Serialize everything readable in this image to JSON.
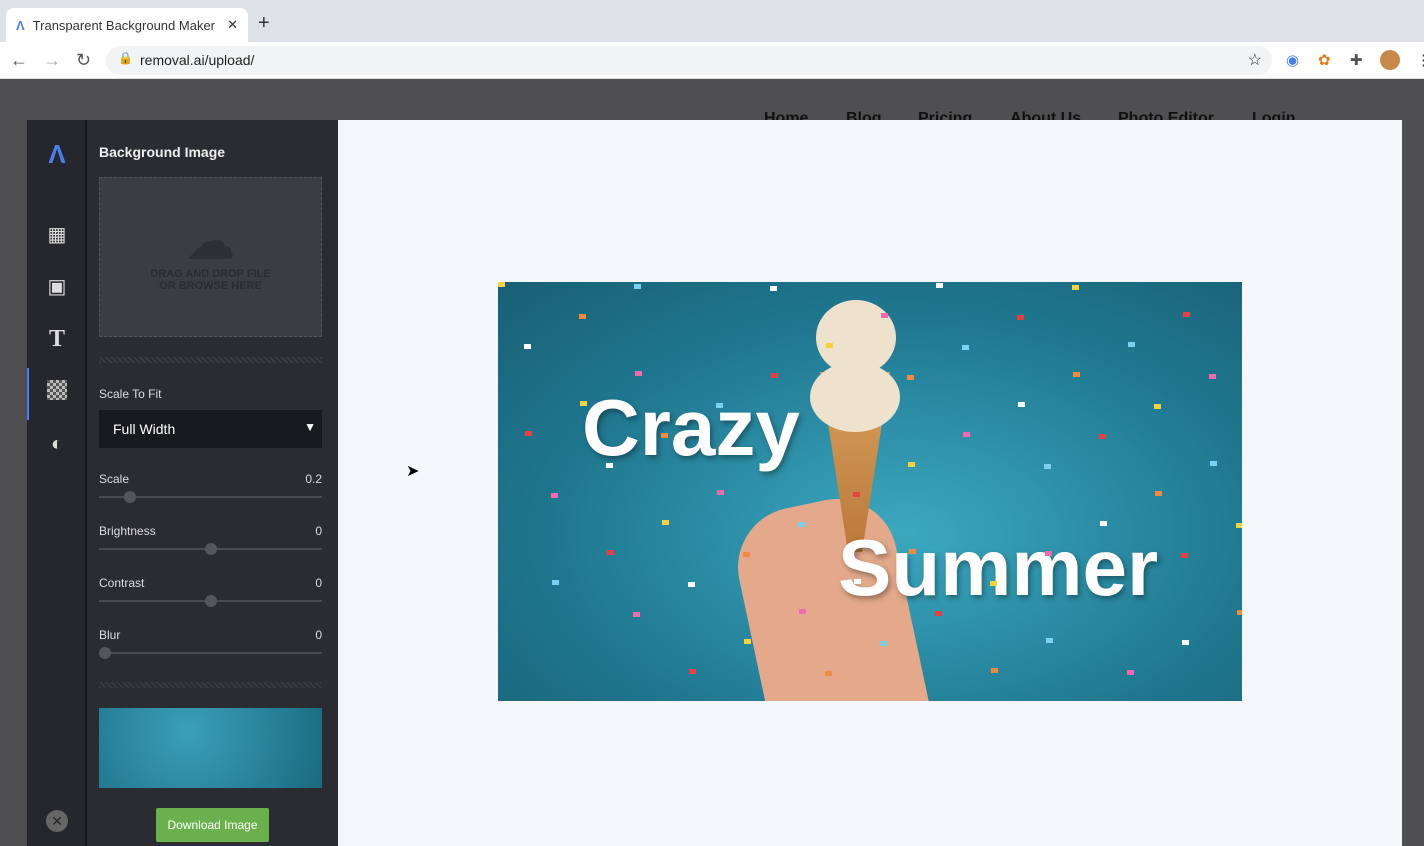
{
  "browser": {
    "tab_title": "Transparent Background Maker",
    "url": "removal.ai/upload/"
  },
  "site_nav": [
    "Home",
    "Blog",
    "Pricing",
    "About Us",
    "Photo Editor",
    "Login"
  ],
  "rail": {
    "items": [
      "layout-icon",
      "image-icon",
      "text-icon",
      "transparency-icon",
      "contrast-icon"
    ],
    "close": "close-icon",
    "active_index": 3
  },
  "panel": {
    "title": "Background Image",
    "dropzone": {
      "line1": "DRAG AND DROP FILE",
      "line2": "OR BROWSE HERE"
    },
    "scale_to_fit_label": "Scale To Fit",
    "scale_to_fit_value": "Full Width",
    "sliders": [
      {
        "label": "Scale",
        "value": "0.2",
        "fraction": 0.12
      },
      {
        "label": "Brightness",
        "value": "0",
        "fraction": 0.5
      },
      {
        "label": "Contrast",
        "value": "0",
        "fraction": 0.5
      },
      {
        "label": "Blur",
        "value": "0",
        "fraction": 0
      }
    ],
    "download_label": "Download Image"
  },
  "canvas": {
    "text1": "Crazy",
    "text2": "Summer"
  },
  "colors": {
    "accent": "#4a7ef0",
    "download": "#6ab04c",
    "panel": "#2b2c32"
  }
}
